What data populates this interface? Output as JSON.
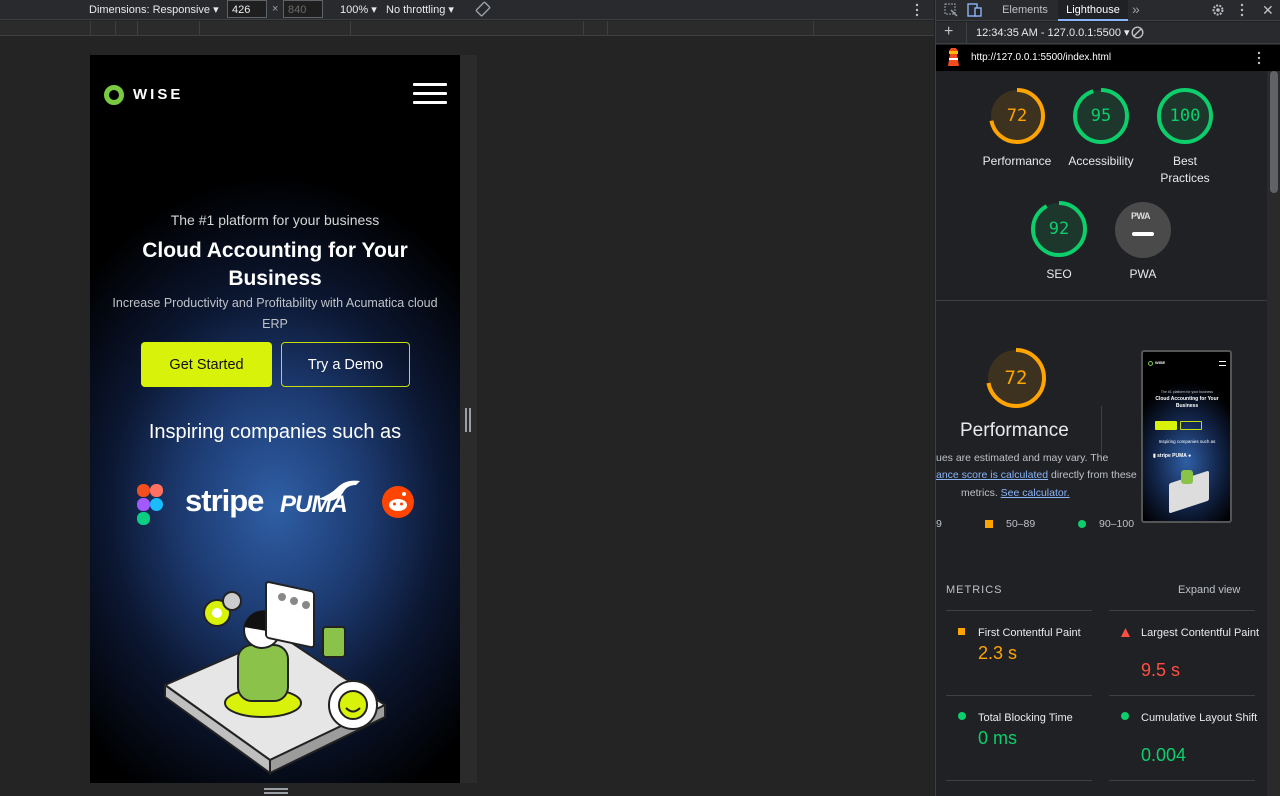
{
  "toolbar": {
    "dimensions_label": "Dimensions: Responsive",
    "width_value": "426",
    "times": "×",
    "height_value": "840",
    "zoom": "100%",
    "throttling": "No throttling"
  },
  "site": {
    "logo_text": "WISE",
    "subtitle": "The #1 platform for your business",
    "headline": "Cloud Accounting for Your Business",
    "description": "Increase Productivity and Profitability with Acumatica cloud ERP",
    "primary_button": "Get Started",
    "secondary_button": "Try a Demo",
    "companies_heading": "Inspiring companies such as",
    "companies": [
      "figma",
      "stripe",
      "PUMA",
      "reddit"
    ]
  },
  "devtools": {
    "tabs": [
      "Elements",
      "Lighthouse"
    ],
    "active_tab": "Lighthouse",
    "report_time": "12:34:35 AM - 127.0.0.1:5500",
    "url": "http://127.0.0.1:5500/index.html"
  },
  "scores": [
    {
      "label": "Performance",
      "value": "72",
      "pct": 0.72,
      "color": "#ffa400"
    },
    {
      "label": "Accessibility",
      "value": "95",
      "pct": 0.95,
      "color": "#0cce6b"
    },
    {
      "label": "Best Practices",
      "value": "100",
      "pct": 1.0,
      "color": "#0cce6b"
    },
    {
      "label": "SEO",
      "value": "92",
      "pct": 0.92,
      "color": "#0cce6b"
    },
    {
      "label": "PWA",
      "value": "",
      "pct": 0,
      "color": "#9aa0a6"
    }
  ],
  "performance": {
    "score": "72",
    "title": "Performance",
    "line1": "ues are estimated and may vary. The",
    "line2_link": "ance score is calculated",
    "line2_rest": " directly from these",
    "line3": "metrics. ",
    "line3_link": "See calculator.",
    "legend_partial": "9",
    "legend_mid": "50–89",
    "legend_good": "90–100"
  },
  "metrics_section": {
    "heading": "METRICS",
    "expand": "Expand view",
    "items": [
      {
        "title": "First Contentful Paint",
        "value": "2.3 s",
        "status": "average"
      },
      {
        "title": "Largest Contentful Paint",
        "value": "9.5 s",
        "status": "poor"
      },
      {
        "title": "Total Blocking Time",
        "value": "0 ms",
        "status": "good"
      },
      {
        "title": "Cumulative Layout Shift",
        "value": "0.004",
        "status": "good"
      }
    ]
  }
}
